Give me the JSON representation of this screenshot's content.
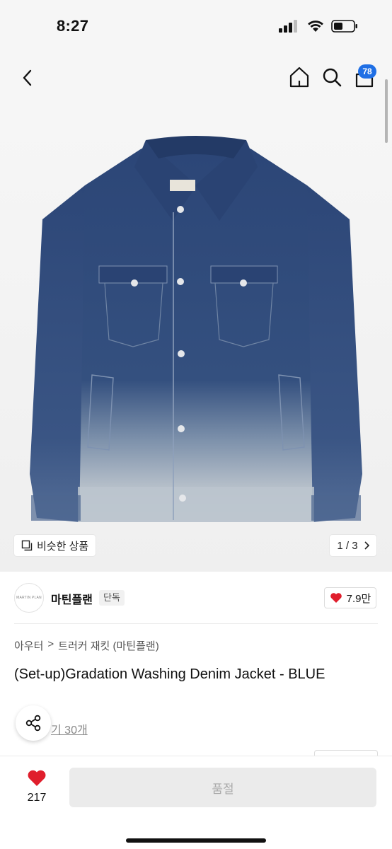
{
  "status": {
    "time": "8:27"
  },
  "header": {
    "cart_count": "78"
  },
  "gallery": {
    "similar_label": "비슷한 상품",
    "page_indicator": "1 / 3"
  },
  "brand": {
    "logo_text": "MARTIN PLAN",
    "name": "마틴플랜",
    "tag": "단독",
    "likes": "7.9만"
  },
  "product": {
    "breadcrumb": [
      "아우터",
      "트러커 재킷 (마틴플랜)"
    ],
    "title": "(Set-up)Gradation Washing Denim Jacket - BLUE",
    "review_link": "후기 30개",
    "review_link_visible": "기 30개"
  },
  "bottom": {
    "wish_count": "217",
    "soldout_label": "품절"
  },
  "colors": {
    "accent": "#1f6fe5",
    "heart": "#e01e2c",
    "denim_dark": "#2e4a7a",
    "denim_faded": "#aab6c3"
  }
}
